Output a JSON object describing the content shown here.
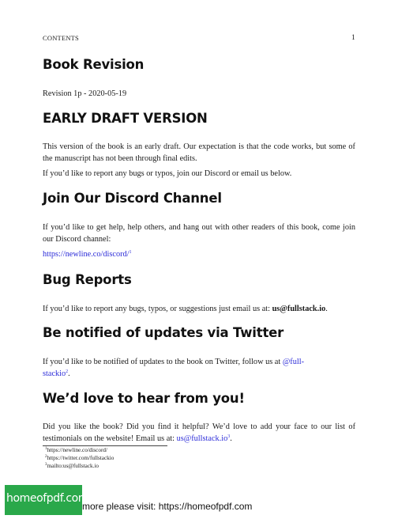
{
  "running_head": {
    "left": "CONTENTS",
    "page_number": "1"
  },
  "sections": {
    "book_revision": {
      "heading": "Book Revision",
      "text": "Revision 1p - 2020-05-19"
    },
    "early_draft": {
      "heading": "EARLY DRAFT VERSION",
      "para1": "This version of the book is an early draft. Our expectation is that the code works, but some of the manuscript has not been through final edits.",
      "para2": "If you’d like to report any bugs or typos, join our Discord or email us below."
    },
    "discord": {
      "heading": "Join Our Discord Channel",
      "para": "If you’d like to get help, help others, and hang out with other readers of this book, come join our Discord channel:",
      "link": "https://newline.co/discord/",
      "sup": "1"
    },
    "bug_reports": {
      "heading": "Bug Reports",
      "text": "If you’d like to report any bugs, typos, or suggestions just email us at: ",
      "email": "us@fullstack.io",
      "tail": "."
    },
    "twitter": {
      "heading": "Be notified of updates via Twitter",
      "text": "If you’d like to be notified of updates to the book on Twitter, follow us at ",
      "handle_a": "@full-",
      "handle_b": "stackio",
      "sup": "2",
      "tail": "."
    },
    "testimonials": {
      "heading": "We’d love to hear from you!",
      "text": "Did you like the book? Did you find it helpful? We’d love to add your face to our list of testimonials on the website! Email us at: ",
      "email": "us@fullstack.io",
      "sup": "3",
      "tail": "."
    }
  },
  "footnotes": [
    {
      "num": "1",
      "text": "https://newline.co/discord/"
    },
    {
      "num": "2",
      "text": "https://twitter.com/fullstackio"
    },
    {
      "num": "3",
      "text": "mailto:us@fullstack.io"
    }
  ],
  "footer": {
    "banner": "homeofpdf.com",
    "text": "more please visit: https://homeofpdf.com"
  },
  "colors": {
    "link": "#2b2bd8",
    "banner": "#2aa84a"
  }
}
